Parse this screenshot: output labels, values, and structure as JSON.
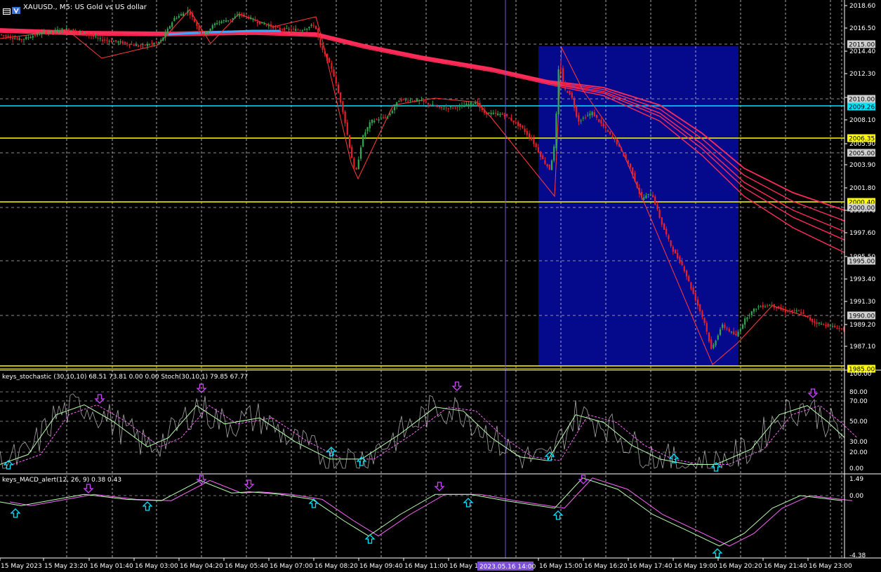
{
  "colors": {
    "background": "#000000",
    "grid": "#c8c8c8",
    "axis_text": "#ffffff",
    "bull": "#2fa84f",
    "bear": "#e8202a",
    "wick": "#b0b0b0",
    "ma": "#ff2b58",
    "ma_blue": "#3aa8ff",
    "zigzag": "#ff3b3b",
    "yellow_level": "#ffff00",
    "cyan_level": "#00e5ff",
    "box_fill": "#050a8c",
    "vline": "#7a4fd6",
    "stoch_main": "#b8ffb0",
    "stoch_signal": "#ff66ff",
    "stoch_raw": "#d0d0d0",
    "macd_main": "#b8ffb0",
    "macd_signal": "#ff66ff",
    "arrow_up": "#00e5ff",
    "arrow_down": "#cc44ff",
    "date_marker_bg": "#7a4fd6"
  },
  "chart_title": "XAUUSD., M5:  US Gold vs US dollar",
  "price_axis": {
    "ticks": [
      "2018.60",
      "2016.50",
      "2014.40",
      "2012.30",
      "2010.20",
      "2008.10",
      "2005.90",
      "2003.90",
      "2001.80",
      "1999.70",
      "1997.60",
      "1995.50",
      "1993.40",
      "1991.30",
      "1989.20",
      "1987.10"
    ],
    "levels": [
      {
        "label": "2015.00",
        "kind": "dash"
      },
      {
        "label": "2010.00",
        "kind": "dash"
      },
      {
        "label": "2009.26",
        "kind": "cyan"
      },
      {
        "label": "2006.35",
        "kind": "yellow"
      },
      {
        "label": "2005.00",
        "kind": "dash"
      },
      {
        "label": "2000.40",
        "kind": "yellow"
      },
      {
        "label": "2000.00",
        "kind": "dash"
      },
      {
        "label": "1995.00",
        "kind": "dash"
      },
      {
        "label": "1990.00",
        "kind": "dash"
      },
      {
        "label": "1985.00",
        "kind": "yellow"
      }
    ]
  },
  "stochastic": {
    "title": "keys_stochastic (30,10,10) 68.51 73.81 0.00 0.00 Stoch(30,10,1) 79.85 67.77",
    "ticks": [
      "100.00",
      "80.00",
      "70.00",
      "50.00",
      "30.00",
      "20.00",
      "0.00"
    ]
  },
  "macd": {
    "title": "keys_MACD_alert(12, 26, 9) 0.38 0.43",
    "ticks": [
      "1.49",
      "0.00",
      "-4.38"
    ]
  },
  "time_axis": {
    "labels": [
      "15 May 2023",
      "15 May 23:20",
      "16 May 01:40",
      "16 May 03:00",
      "16 May 04:20",
      "16 May 05:40",
      "16 May 07:00",
      "16 May 08:20",
      "16 May 09:40",
      "16 May 11:00",
      "16 May 1",
      "16 May 15:00",
      "16 May 16:20",
      "16 May 17:40",
      "16 May 19:00",
      "16 May 20:20",
      "16 May 21:40",
      "16 May 23:00"
    ],
    "marker": "2023.05.16 14:00"
  }
}
